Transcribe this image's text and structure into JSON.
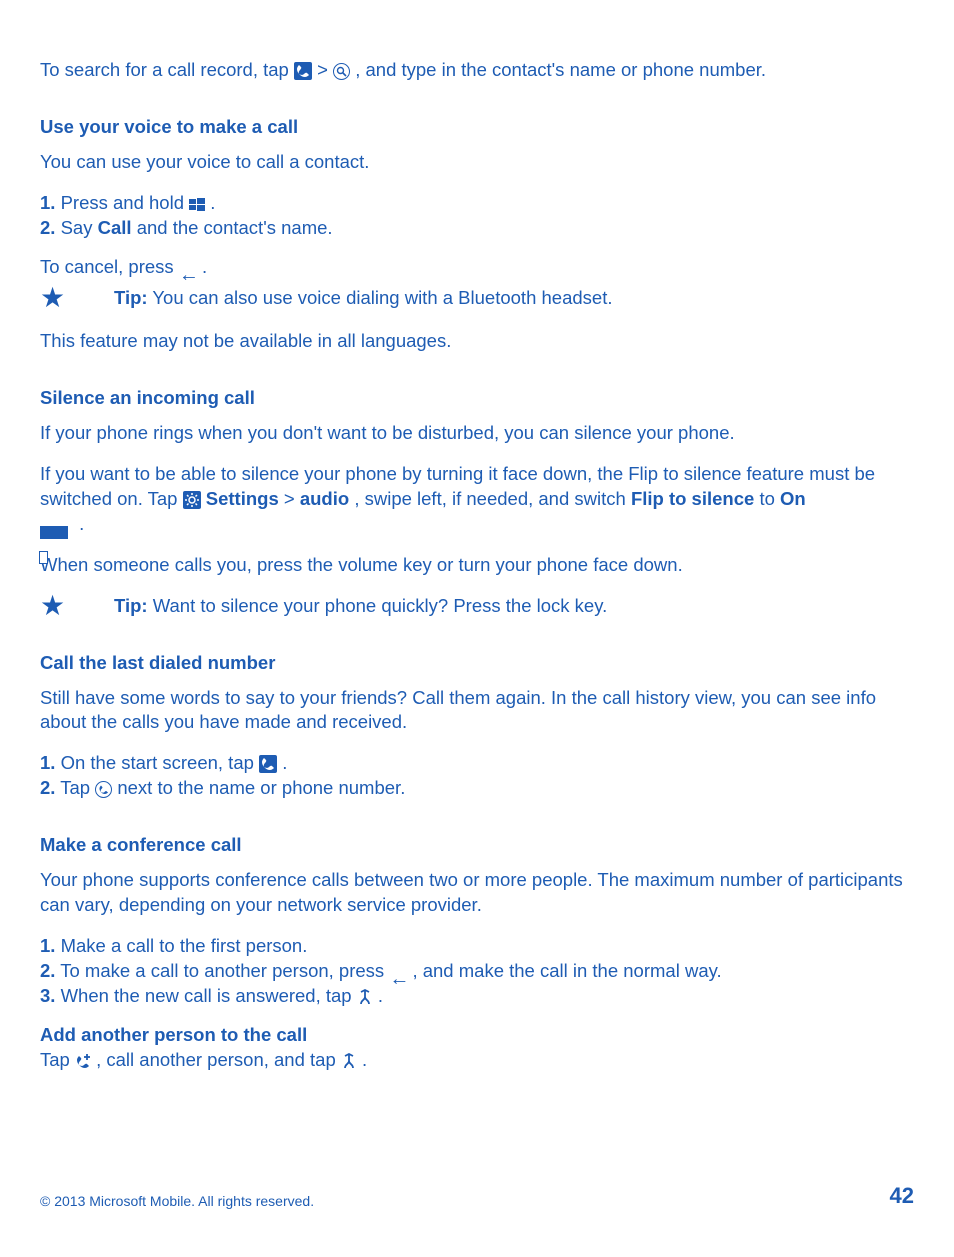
{
  "search_line": {
    "pre": "To search for a call record, tap ",
    "gt": " > ",
    "post": ", and type in the contact's name or phone number."
  },
  "s_voice": {
    "heading": "Use your voice to make a call",
    "p1": "You can use your voice to call a contact.",
    "step1_num": "1.",
    "step1_text": " Press and hold ",
    "step1_end": ".",
    "step2_num": "2.",
    "step2_text_a": " Say ",
    "step2_call": "Call",
    "step2_text_b": " and the contact's name.",
    "cancel_pre": "To cancel, press ",
    "cancel_post": ".",
    "tip_label": "Tip:",
    "tip_text": " You can also use voice dialing with a Bluetooth headset.",
    "note": "This feature may not be available in all languages."
  },
  "s_silence": {
    "heading": "Silence an incoming call",
    "p1": "If your phone rings when you don't want to be disturbed, you can silence your phone.",
    "p2a": "If you want to be able to silence your phone by turning it face down, the Flip to silence feature must be switched on. Tap ",
    "settings": "Settings",
    "gt": " > ",
    "audio": "audio",
    "p2b": ", swipe left, if needed, and switch ",
    "flip": "Flip to silence",
    "to": " to ",
    "on": "On",
    "p2c": ".",
    "p3": "When someone calls you, press the volume key or turn your phone face down.",
    "tip_label": "Tip:",
    "tip_text": " Want to silence your phone quickly? Press the lock key."
  },
  "s_last": {
    "heading": "Call the last dialed number",
    "p1": "Still have some words to say to your friends? Call them again. In the call history view, you can see info about the calls you have made and received.",
    "step1_num": "1.",
    "step1_text": " On the start screen, tap ",
    "step1_end": ".",
    "step2_num": "2.",
    "step2_a": " Tap ",
    "step2_b": " next to the name or phone number."
  },
  "s_conf": {
    "heading": "Make a conference call",
    "p1": "Your phone supports conference calls between two or more people. The maximum number of participants can vary, depending on your network service provider.",
    "step1_num": "1.",
    "step1_text": " Make a call to the first person.",
    "step2_num": "2.",
    "step2_a": " To make a call to another person, press ",
    "step2_b": ", and make the call in the normal way.",
    "step3_num": "3.",
    "step3_a": " When the new call is answered, tap ",
    "step3_b": ".",
    "sub_heading": "Add another person to the call",
    "sub_a": "Tap ",
    "sub_b": ", call another person, and tap ",
    "sub_c": "."
  },
  "footer": {
    "copyright": "© 2013 Microsoft Mobile. All rights reserved.",
    "page": "42"
  }
}
